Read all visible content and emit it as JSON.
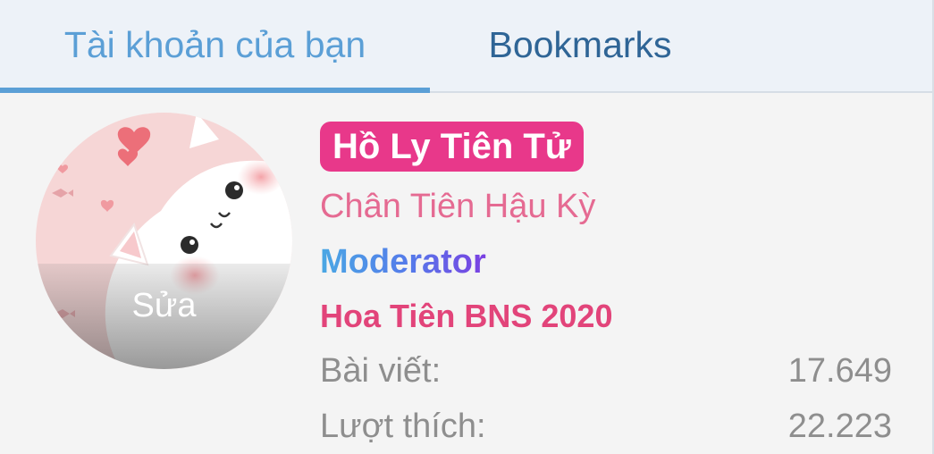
{
  "tabs": {
    "account": "Tài khoản của bạn",
    "bookmarks": "Bookmarks"
  },
  "avatar": {
    "edit_label": "Sửa"
  },
  "profile": {
    "username": "Hồ Ly Tiên Tử",
    "rank": "Chân Tiên Hậu Kỳ",
    "role": "Moderator",
    "banner": "Hoa Tiên BNS 2020"
  },
  "stats": {
    "posts_label": "Bài viết:",
    "posts_value": "17.649",
    "likes_label": "Lượt thích:",
    "likes_value": "22.223"
  },
  "colors": {
    "tab_active": "#5b9fd6",
    "tab_inactive": "#2f6596",
    "username_bg": "#e8388a",
    "rank": "#e56a92",
    "banner": "#e2447a",
    "stat_text": "#8e8e8e"
  }
}
